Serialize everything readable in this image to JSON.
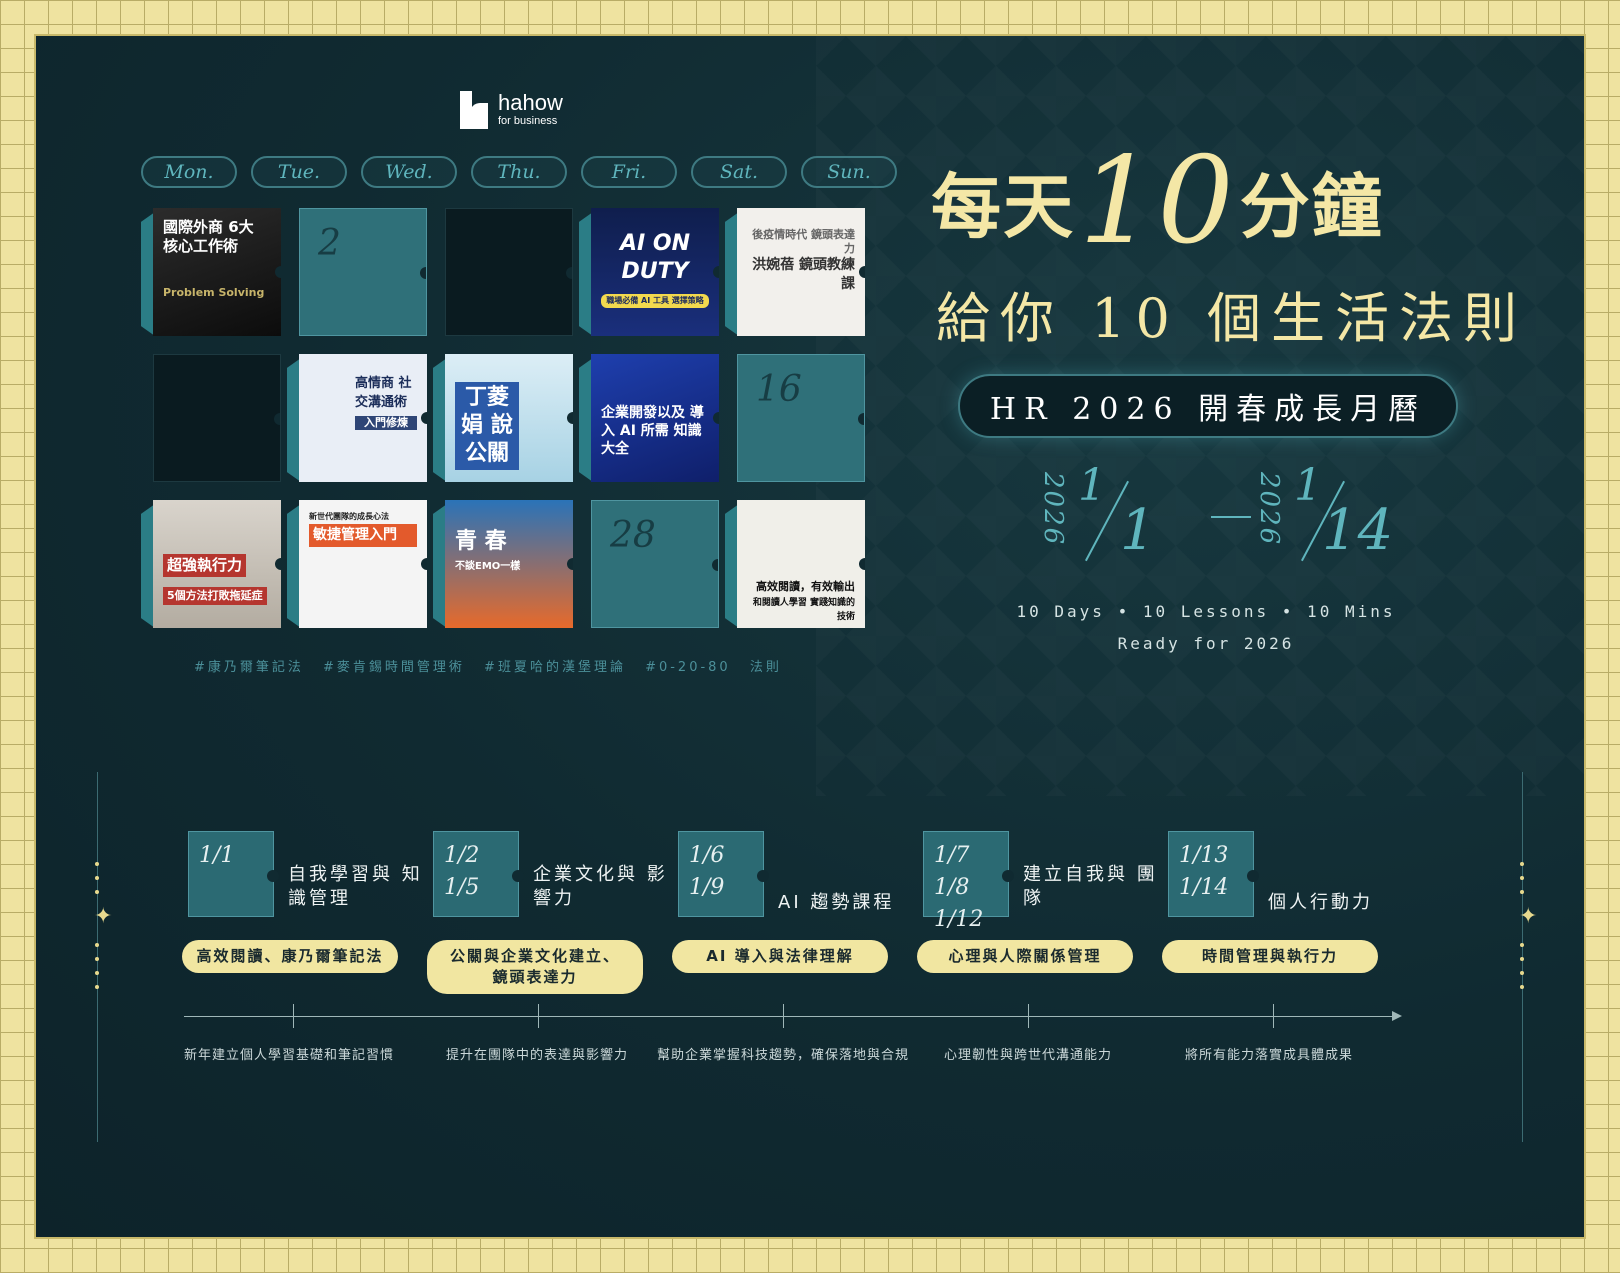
{
  "brand": {
    "name": "hahow",
    "sub": "for business"
  },
  "weekdays": [
    "Mon.",
    "Tue.",
    "Wed.",
    "Thu.",
    "Fri.",
    "Sat.",
    "Sun."
  ],
  "cells": {
    "c1": {
      "title": "國際外商 6大 核心工作術",
      "sub": "Problem Solving"
    },
    "c2": {
      "num": "2"
    },
    "c4": {
      "title": "AI ON DUTY",
      "sub": "職場必備 AI 工具 選擇策略"
    },
    "c5": {
      "title": "洪婉蓓 鏡頭教練課",
      "sub": "後疫情時代 鏡頭表達力"
    },
    "c7": {
      "title": "高情商 社交溝通術",
      "sub": "入門修煉"
    },
    "c8": {
      "title": "丁菱娟 說公關",
      "sub": ""
    },
    "c9": {
      "title": "企業開發以及 導入 AI 所需 知識大全",
      "sub": ""
    },
    "c10": {
      "num": "16"
    },
    "c11": {
      "title": "超強執行力",
      "sub": "5個方法打敗拖延症"
    },
    "c12": {
      "title": "敏捷管理入門",
      "sub": "新世代團隊的成長心法"
    },
    "c13": {
      "title": "青 春",
      "sub": "不談EMO一樣"
    },
    "c14": {
      "num": "28"
    },
    "c15": {
      "title": "高效閱讀，有效輸出",
      "sub": "和閱讀人學習 實踐知識的技術"
    }
  },
  "hashtags": "#康乃爾筆記法 #麥肯錫時間管理術 #班夏哈的漢堡理論 #0-20-80 法則",
  "headline": {
    "pre": "每天",
    "ten": "10",
    "post": "分鐘",
    "line2": "給你 10 個生活法則"
  },
  "banner": "HR 2026 開春成長月曆",
  "dates": {
    "year": "2026",
    "start_m": "1",
    "start_d": "1",
    "end_m": "1",
    "end_d": "14"
  },
  "tagline": {
    "line1": "10 Days • 10 Lessons • 10 Mins",
    "line2": "Ready for 2026"
  },
  "timeline": [
    {
      "dates": "1/1",
      "dates2": "",
      "topic": "自我學習與 知識管理",
      "pill": "高效閱讀、康乃爾筆記法",
      "desc": "新年建立個人學習基礎和筆記習慣"
    },
    {
      "dates": "1/2",
      "dates2": "1/5",
      "topic": "企業文化與 影響力",
      "pill": "公關與企業文化建立、 鏡頭表達力",
      "desc": "提升在團隊中的表達與影響力"
    },
    {
      "dates": "1/6",
      "dates2": "1/9",
      "topic": "AI 趨勢課程",
      "pill": "AI 導入與法律理解",
      "desc": "幫助企業掌握科技趨勢，確保落地與合規"
    },
    {
      "dates": "1/7 1/8",
      "dates2": "1/12",
      "topic": "建立自我與 團隊",
      "pill": "心理與人際關係管理",
      "desc": "心理韌性與跨世代溝通能力"
    },
    {
      "dates": "1/13",
      "dates2": "1/14",
      "topic": "個人行動力",
      "pill": "時間管理與執行力",
      "desc": "將所有能力落實成具體成果"
    }
  ]
}
